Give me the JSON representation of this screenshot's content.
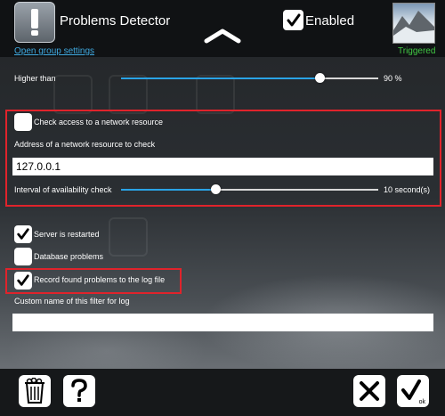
{
  "header": {
    "title": "Problems Detector",
    "group_link": "Open group settings",
    "enabled_label": "Enabled",
    "enabled_checked": true,
    "status": "Triggered",
    "status_color": "#42c945"
  },
  "higher_than": {
    "label": "Higher than",
    "value_text": "90 %",
    "level_fraction": 0.75
  },
  "network_check": {
    "checkbox_label": "Check access to a network resource",
    "checked": false,
    "address_label": "Address of a network resource to check",
    "address_value": "127.0.0.1",
    "interval_label": "Interval of availability check",
    "interval_value_text": "10 second(s)",
    "interval_level_fraction": 0.37
  },
  "options": [
    {
      "label": "Server is restarted",
      "checked": true
    },
    {
      "label": "Database problems",
      "checked": false
    },
    {
      "label": "Record found problems to the log file",
      "checked": true
    }
  ],
  "log_name": {
    "label": "Custom name of this filter for log",
    "value": ""
  },
  "footer": {
    "delete_icon": "trash-can-icon",
    "help_icon": "question-mark-icon",
    "cancel_icon": "close-x-icon",
    "ok_icon": "checkmark-ok-icon",
    "ok_caption": "ok"
  },
  "colors": {
    "accent": "#2aa4e6",
    "highlight_frame": "#e0232b",
    "link": "#3fa9e0"
  }
}
